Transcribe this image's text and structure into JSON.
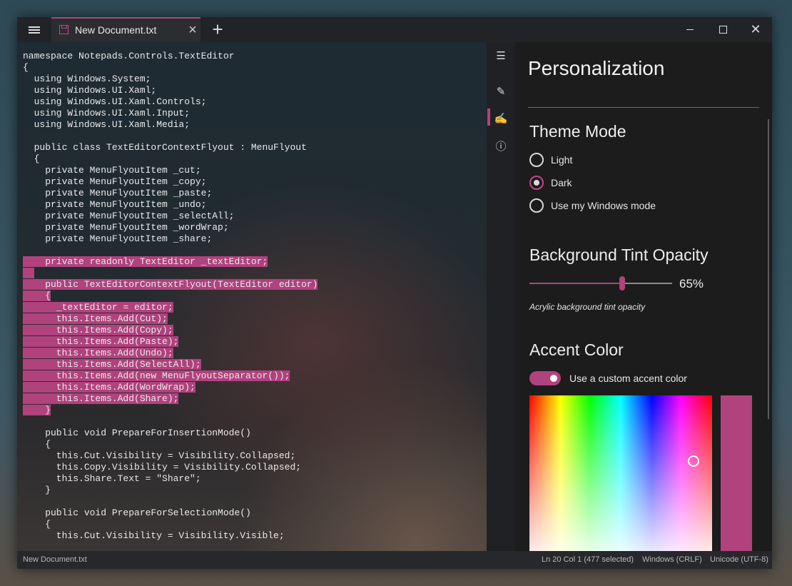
{
  "tab": {
    "title": "New Document.txt"
  },
  "editor": {
    "lines": [
      {
        "text": "namespace Notepads.Controls.TextEditor",
        "sel": false
      },
      {
        "text": "{",
        "sel": false
      },
      {
        "text": "  using Windows.System;",
        "sel": false
      },
      {
        "text": "  using Windows.UI.Xaml;",
        "sel": false
      },
      {
        "text": "  using Windows.UI.Xaml.Controls;",
        "sel": false
      },
      {
        "text": "  using Windows.UI.Xaml.Input;",
        "sel": false
      },
      {
        "text": "  using Windows.UI.Xaml.Media;",
        "sel": false
      },
      {
        "text": "",
        "sel": false
      },
      {
        "text": "  public class TextEditorContextFlyout : MenuFlyout",
        "sel": false
      },
      {
        "text": "  {",
        "sel": false
      },
      {
        "text": "    private MenuFlyoutItem _cut;",
        "sel": false
      },
      {
        "text": "    private MenuFlyoutItem _copy;",
        "sel": false
      },
      {
        "text": "    private MenuFlyoutItem _paste;",
        "sel": false
      },
      {
        "text": "    private MenuFlyoutItem _undo;",
        "sel": false
      },
      {
        "text": "    private MenuFlyoutItem _selectAll;",
        "sel": false
      },
      {
        "text": "    private MenuFlyoutItem _wordWrap;",
        "sel": false
      },
      {
        "text": "    private MenuFlyoutItem _share;",
        "sel": false
      },
      {
        "text": "",
        "sel": false
      },
      {
        "text": "    private readonly TextEditor _textEditor;",
        "sel": true
      },
      {
        "text": "",
        "sel": true
      },
      {
        "text": "    public TextEditorContextFlyout(TextEditor editor)",
        "sel": true
      },
      {
        "text": "    {",
        "sel": true
      },
      {
        "text": "      _textEditor = editor;",
        "sel": true
      },
      {
        "text": "      this.Items.Add(Cut);",
        "sel": true
      },
      {
        "text": "      this.Items.Add(Copy);",
        "sel": true
      },
      {
        "text": "      this.Items.Add(Paste);",
        "sel": true
      },
      {
        "text": "      this.Items.Add(Undo);",
        "sel": true
      },
      {
        "text": "      this.Items.Add(SelectAll);",
        "sel": true
      },
      {
        "text": "      this.Items.Add(new MenuFlyoutSeparator());",
        "sel": true
      },
      {
        "text": "      this.Items.Add(WordWrap);",
        "sel": true
      },
      {
        "text": "      this.Items.Add(Share);",
        "sel": true
      },
      {
        "text": "    }",
        "sel": true
      },
      {
        "text": "",
        "sel": false
      },
      {
        "text": "    public void PrepareForInsertionMode()",
        "sel": false
      },
      {
        "text": "    {",
        "sel": false
      },
      {
        "text": "      this.Cut.Visibility = Visibility.Collapsed;",
        "sel": false
      },
      {
        "text": "      this.Copy.Visibility = Visibility.Collapsed;",
        "sel": false
      },
      {
        "text": "      this.Share.Text = \"Share\";",
        "sel": false
      },
      {
        "text": "    }",
        "sel": false
      },
      {
        "text": "",
        "sel": false
      },
      {
        "text": "    public void PrepareForSelectionMode()",
        "sel": false
      },
      {
        "text": "    {",
        "sel": false
      },
      {
        "text": "      this.Cut.Visibility = Visibility.Visible;",
        "sel": false
      }
    ]
  },
  "sidenav": {
    "items": [
      {
        "name": "sidenav-menu-icon",
        "icon": "☰"
      },
      {
        "name": "sidenav-text-editing-icon",
        "icon": "✎"
      },
      {
        "name": "sidenav-personalization-icon",
        "icon": "✍"
      },
      {
        "name": "sidenav-about-icon",
        "icon": "ⓘ"
      }
    ]
  },
  "panel": {
    "title": "Personalization",
    "theme": {
      "heading": "Theme Mode",
      "options": [
        "Light",
        "Dark",
        "Use my Windows mode"
      ],
      "selected": "Dark"
    },
    "tint": {
      "heading": "Background Tint Opacity",
      "value": 0.65,
      "value_label": "65%",
      "caption": "Acrylic background tint opacity"
    },
    "accent": {
      "heading": "Accent Color",
      "toggle_label": "Use a custom accent color",
      "toggle_on": true,
      "color": "#b0427e"
    }
  },
  "status": {
    "filename": "New Document.txt",
    "position": "Ln 20 Col 1 (477 selected)",
    "line_ending": "Windows (CRLF)",
    "encoding": "Unicode (UTF-8)"
  },
  "colors": {
    "accent": "#b0427e"
  }
}
